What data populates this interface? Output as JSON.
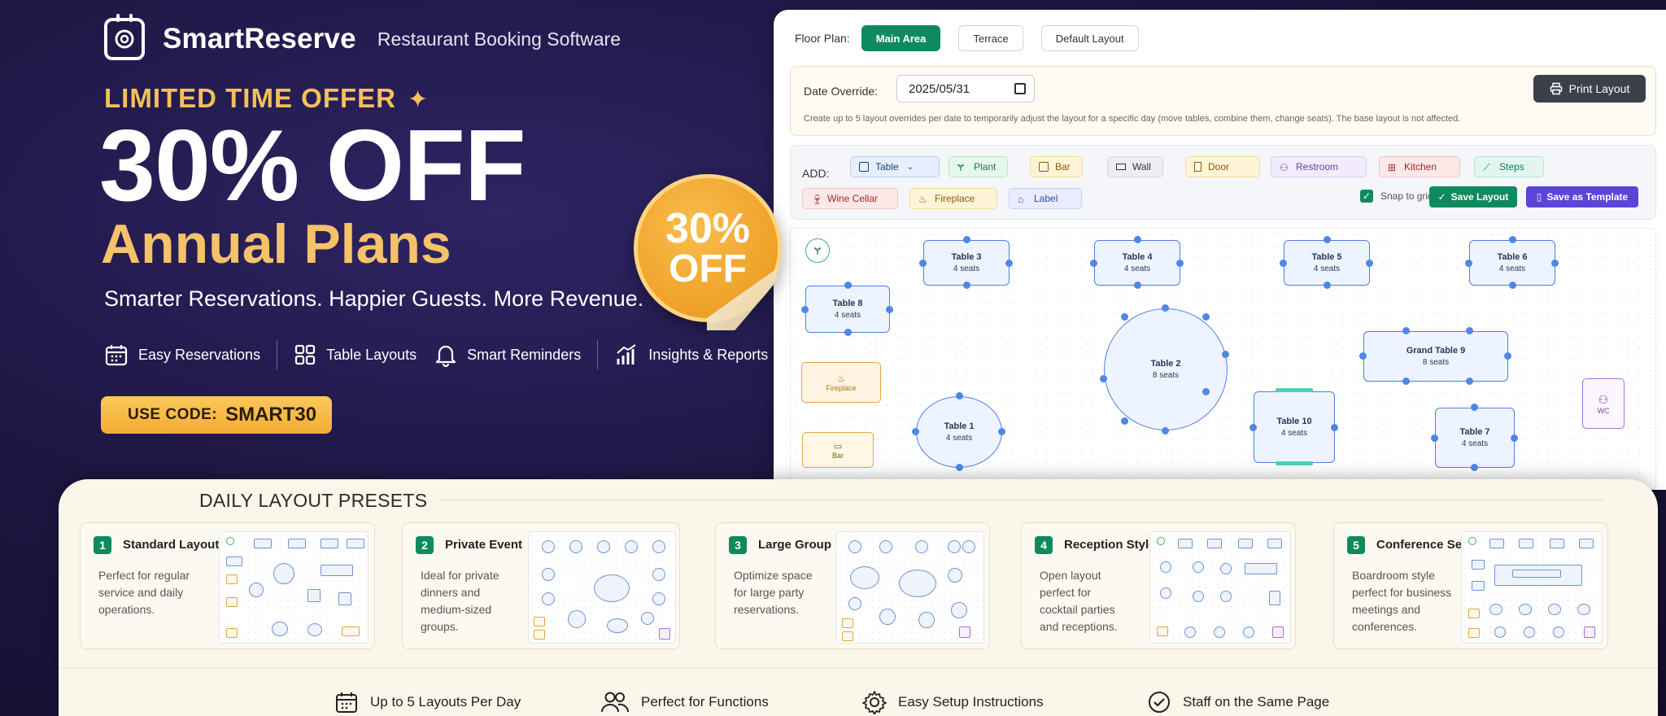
{
  "brand": {
    "name": "SmartReserve",
    "tagline": "Restaurant Booking Software"
  },
  "hero": {
    "offer_label": "LIMITED TIME OFFER",
    "headline": "30% OFF",
    "subheadline": "Annual Plans",
    "tagline": "Smarter Reservations. Happier Guests. More Revenue.",
    "features": [
      "Easy Reservations",
      "Table Layouts",
      "Smart Reminders",
      "Insights & Reports"
    ],
    "promo_label": "USE CODE:",
    "promo_code": "SMART30",
    "badge_pct": "30%",
    "badge_off": "OFF"
  },
  "app": {
    "floor_label": "Floor Plan:",
    "floor_tabs": [
      "Main Area",
      "Terrace",
      "Default Layout"
    ],
    "date_label": "Date Override:",
    "date_value": "2025/05/31",
    "override_note": "Create up to 5 layout overrides per date to temporarily adjust the layout for a specific day (move tables, combine them, change seats). The base layout is not affected.",
    "print_label": "Print Layout",
    "add_label": "ADD:",
    "add_items": [
      "Table",
      "Plant",
      "Bar",
      "Wall",
      "Door",
      "Restroom",
      "Kitchen",
      "Steps",
      "Wine Cellar",
      "Fireplace",
      "Label"
    ],
    "snap_label": "Snap to grid",
    "save_label": "Save Layout",
    "template_label": "Save as Template",
    "tables": [
      {
        "name": "Table 3",
        "seats": "4 seats"
      },
      {
        "name": "Table 4",
        "seats": "4 seats"
      },
      {
        "name": "Table 5",
        "seats": "4 seats"
      },
      {
        "name": "Table 6",
        "seats": "4 seats"
      },
      {
        "name": "Table 8",
        "seats": "4 seats"
      },
      {
        "name": "Table 2",
        "seats": "8 seats"
      },
      {
        "name": "Grand Table 9",
        "seats": "8 seats"
      },
      {
        "name": "Table 1",
        "seats": "4 seats"
      },
      {
        "name": "Table 10",
        "seats": "4 seats"
      },
      {
        "name": "Table 7",
        "seats": "4 seats"
      }
    ],
    "fireplace_label": "Fireplace",
    "bar_label": "Bar",
    "wc_label": "WC"
  },
  "presets": {
    "title": "DAILY LAYOUT PRESETS",
    "cards": [
      {
        "num": "1",
        "title": "Standard Layout",
        "desc": [
          "Perfect for regular",
          "service and daily",
          "operations."
        ]
      },
      {
        "num": "2",
        "title": "Private Event",
        "desc": [
          "Ideal for private",
          "dinners and",
          "medium-sized",
          "groups."
        ]
      },
      {
        "num": "3",
        "title": "Large Group",
        "desc": [
          "Optimize space",
          "for large party",
          "reservations."
        ]
      },
      {
        "num": "4",
        "title": "Reception Style",
        "desc": [
          "Open layout",
          "perfect for",
          "cocktail parties",
          "and receptions."
        ]
      },
      {
        "num": "5",
        "title": "Conference Setup",
        "desc": [
          "Boardroom style",
          "perfect for business",
          "meetings and",
          "conferences."
        ]
      }
    ],
    "bottom_features": [
      "Up to 5 Layouts Per Day",
      "Perfect for Functions",
      "Easy Setup Instructions",
      "Staff on the Same Page"
    ]
  },
  "colors": {
    "accent_green": "#0f8a5f",
    "accent_purple": "#5a45d8",
    "gold": "#f5c26a",
    "hero_bg": "#1c1641"
  }
}
